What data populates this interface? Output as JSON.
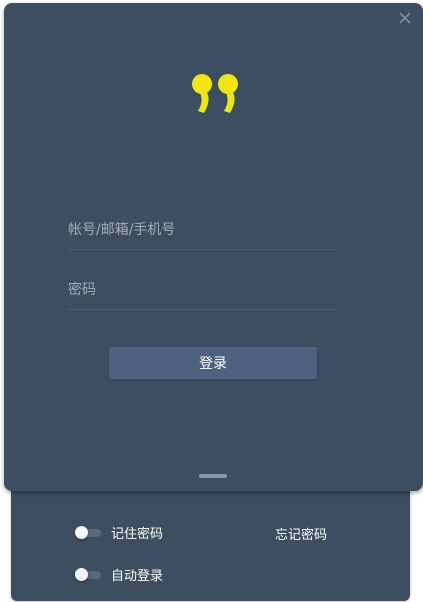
{
  "login": {
    "account_placeholder": "帐号/邮箱/手机号",
    "account_value": "",
    "password_placeholder": "密码",
    "password_value": "",
    "login_button": "登录"
  },
  "options": {
    "remember_password": {
      "label": "记住密码",
      "checked": false
    },
    "auto_login": {
      "label": "自动登录",
      "checked": false
    },
    "forgot_password": "忘记密码"
  },
  "icons": {
    "logo": "quote-logo-icon",
    "close": "close-icon"
  },
  "colors": {
    "panel": "#3c4e5f",
    "button": "#4c6280",
    "logo": "#f0e612"
  }
}
